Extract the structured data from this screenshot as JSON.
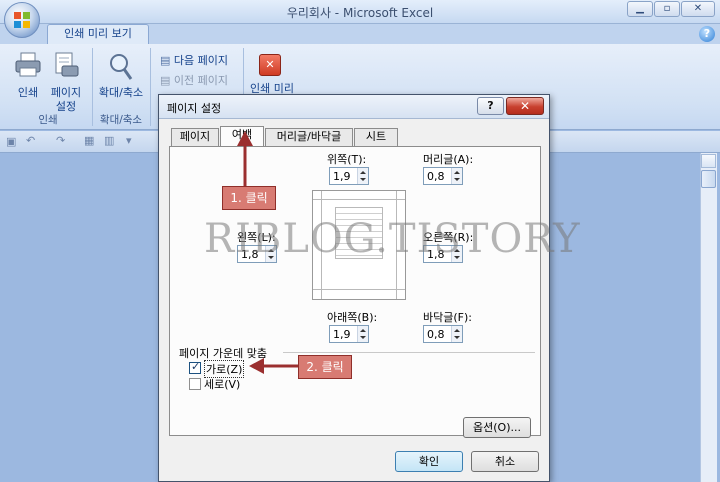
{
  "window": {
    "title": "우리회사 - Microsoft Excel"
  },
  "ribbon": {
    "tab_label": "인쇄 미리 보기",
    "print_group": {
      "print_label": "인쇄",
      "page_setup_label_1": "페이지",
      "page_setup_label_2": "설정",
      "group_label": "인쇄"
    },
    "zoom_group": {
      "zoom_label": "확대/축소",
      "group_label": "확대/축소"
    },
    "preview_group": {
      "next_page": "다음 페이지",
      "prev_page": "이전 페이지",
      "close_label": "인쇄 미리"
    }
  },
  "dialog": {
    "title": "페이지 설정",
    "tabs": [
      "페이지",
      "여백",
      "머리글/바닥글",
      "시트"
    ],
    "active_tab": "여백",
    "top": {
      "label": "위쪽(T):",
      "value": "1,9"
    },
    "header": {
      "label": "머리글(A):",
      "value": "0,8"
    },
    "left": {
      "label": "왼쪽(L):",
      "value": "1,8"
    },
    "right": {
      "label": "오른쪽(R):",
      "value": "1,8"
    },
    "bottom": {
      "label": "아래쪽(B):",
      "value": "1,9"
    },
    "footer": {
      "label": "바닥글(F):",
      "value": "0,8"
    },
    "center_on_page": {
      "label": "페이지 가운데 맞춤",
      "horizontal": {
        "label": "가로(Z)",
        "checked": true
      },
      "vertical": {
        "label": "세로(V)",
        "checked": false
      }
    },
    "options_button": "옵션(O)...",
    "ok_button": "확인",
    "cancel_button": "취소"
  },
  "annotations": {
    "step1": "1. 클릭",
    "step2": "2. 클릭",
    "watermark": "RIBLOG.TISTORY"
  },
  "colors": {
    "callout": "#d87b73",
    "arrow": "#9b2f2f",
    "ribbon": "#dfeaf8"
  }
}
